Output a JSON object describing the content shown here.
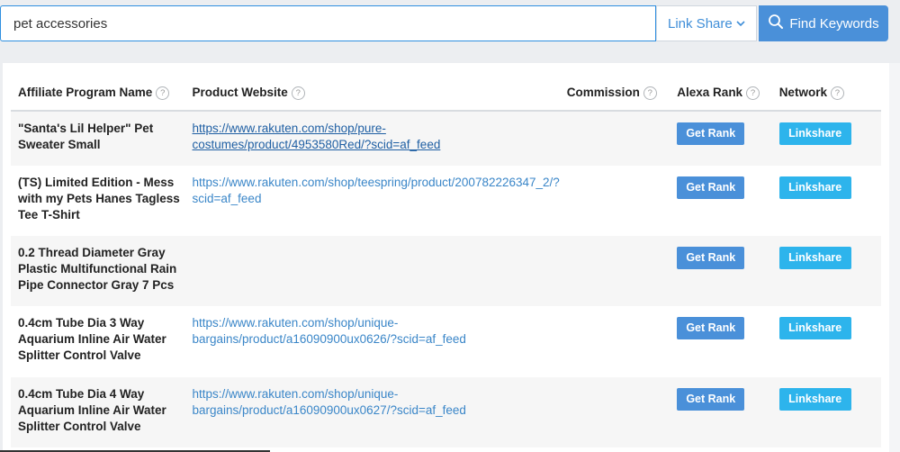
{
  "search": {
    "query": "pet accessories",
    "network_selected": "Link Share",
    "find_label": "Find Keywords"
  },
  "table": {
    "headers": {
      "name": "Affiliate Program Name",
      "website": "Product Website",
      "commission": "Commission",
      "alexa": "Alexa Rank",
      "network": "Network"
    },
    "help_glyph": "?",
    "rows": [
      {
        "name": "\"Santa's Lil Helper\" Pet Sweater Small",
        "url": "https://www.rakuten.com/shop/pure-costumes/product/4953580Red/?scid=af_feed",
        "commission": "",
        "alexa_button": "Get Rank",
        "network_button": "Linkshare"
      },
      {
        "name": "(TS) Limited Edition - Mess with my Pets Hanes Tagless Tee T-Shirt",
        "url": "https://www.rakuten.com/shop/teespring/product/200782226347_2/?scid=af_feed",
        "commission": "",
        "alexa_button": "Get Rank",
        "network_button": "Linkshare"
      },
      {
        "name": "0.2 Thread Diameter Gray Plastic Multifunctional Rain Pipe Connector Gray 7 Pcs",
        "url": "",
        "commission": "",
        "alexa_button": "Get Rank",
        "network_button": "Linkshare"
      },
      {
        "name": "0.4cm Tube Dia 3 Way Aquarium Inline Air Water Splitter Control Valve",
        "url": "https://www.rakuten.com/shop/unique-bargains/product/a16090900ux0626/?scid=af_feed",
        "commission": "",
        "alexa_button": "Get Rank",
        "network_button": "Linkshare"
      },
      {
        "name": "0.4cm Tube Dia 4 Way Aquarium Inline Air Water Splitter Control Valve",
        "url": "https://www.rakuten.com/shop/unique-bargains/product/a16090900ux0627/?scid=af_feed",
        "commission": "",
        "alexa_button": "Get Rank",
        "network_button": "Linkshare"
      }
    ]
  }
}
